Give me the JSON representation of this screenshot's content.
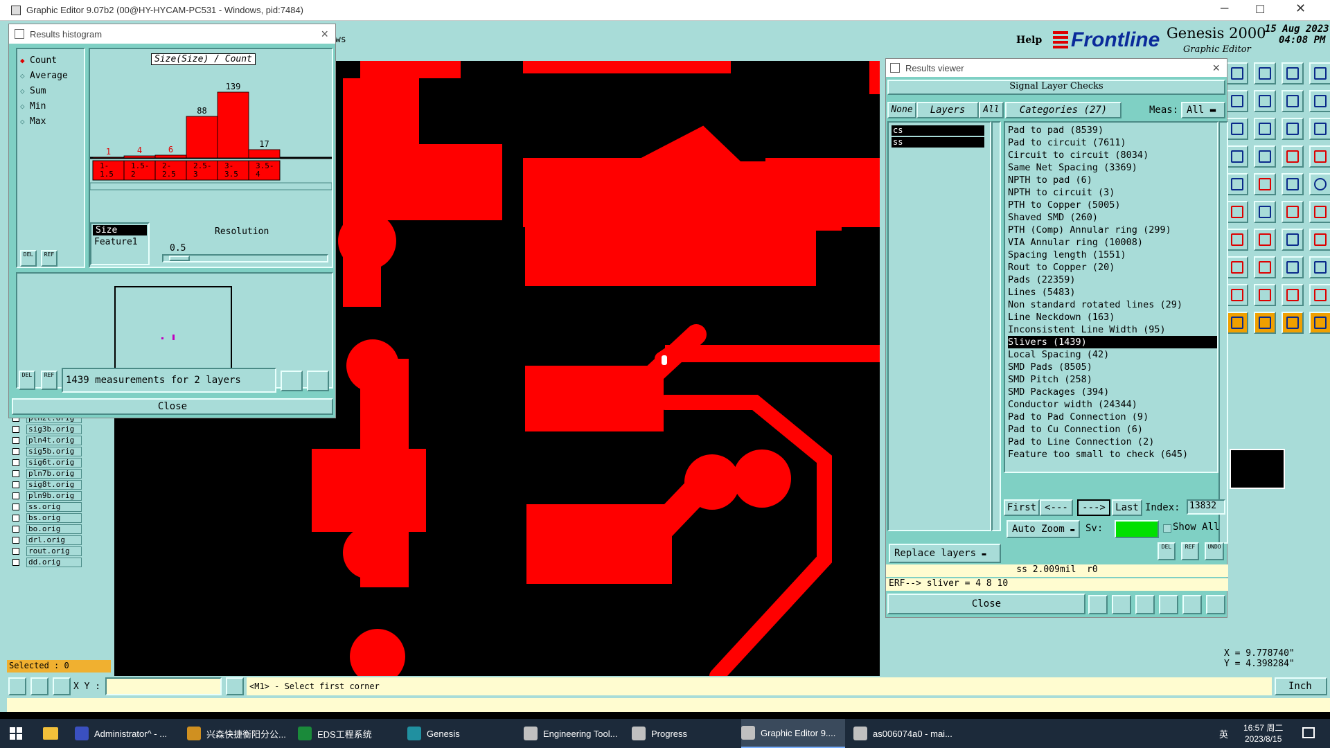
{
  "app": {
    "title": "Graphic Editor 9.07b2 (00@HY-HYCAM-PC531 - Windows, pid:7484)",
    "menu_fragment": "ws",
    "help_label": "Help",
    "brand": "Frontline",
    "product": "Genesis 2000",
    "subtitle": "Graphic Editor",
    "date": "15 Aug 2023",
    "time": "04:08 PM"
  },
  "histogram": {
    "title": "Results histogram",
    "close_x": "×",
    "options": [
      "Count",
      "Average",
      "Sum",
      "Min",
      "Max"
    ],
    "selected_option": "Count",
    "header": "Size(Size) / Count",
    "size_label": "Size",
    "feature_label": "Feature1",
    "resolution_label": "Resolution",
    "resolution_value": "0.5",
    "del_label": "DEL",
    "ref_label": "REF",
    "measurements": "1439 measurements for 2 layers",
    "close_label": "Close"
  },
  "chart_data": {
    "type": "bar",
    "title": "Size(Size) / Count",
    "categories": [
      "1-1.5",
      "1.5-2",
      "2-2.5",
      "2.5-3",
      "3-3.5",
      "3.5-4"
    ],
    "category_lines": [
      [
        "1-",
        "1.5"
      ],
      [
        "1.5-",
        "2"
      ],
      [
        "2-",
        "2.5"
      ],
      [
        "2.5-",
        "3"
      ],
      [
        "3-",
        "3.5"
      ],
      [
        "3.5-",
        "4"
      ]
    ],
    "values": [
      1,
      4,
      6,
      88,
      139,
      17
    ],
    "ymax": 139,
    "colors": {
      "bar": "#ff0000",
      "label_low": "#e00000",
      "label_high": "#000000"
    }
  },
  "layers": [
    "pln2t.orig",
    "sig3b.orig",
    "pln4t.orig",
    "sig5b.orig",
    "sig6t.orig",
    "pln7b.orig",
    "sig8t.orig",
    "pln9b.orig",
    "ss.orig",
    "bs.orig",
    "bo.orig",
    "drl.orig",
    "rout.orig",
    "dd.orig"
  ],
  "status": {
    "selected": "Selected : 0",
    "xy_label": "X Y :",
    "xy_value": "",
    "prompt": "<M1> - Select first corner",
    "unit": "Inch",
    "x_coord": "X = 9.778740\"",
    "y_coord": "Y = 4.398284\""
  },
  "results": {
    "title": "Results viewer",
    "close_x": "×",
    "heading": "Signal Layer Checks",
    "none_label": "None",
    "layers_label": "Layers",
    "all_label": "All",
    "categories_label": "Categories (27)",
    "meas_label": "Meas:",
    "meas_value": "All",
    "layer_items": [
      "cs",
      "ss"
    ],
    "categories": [
      "Pad to pad (8539)",
      "Pad to circuit (7611)",
      "Circuit to circuit (8034)",
      "Same Net Spacing (3369)",
      "NPTH to pad (6)",
      "NPTH to circuit (3)",
      "PTH to Copper (5005)",
      "Shaved SMD (260)",
      "PTH (Comp) Annular ring (299)",
      "VIA Annular ring (10008)",
      "Spacing length (1551)",
      "Rout to Copper (20)",
      "Pads (22359)",
      "Lines (5483)",
      "Non standard rotated lines (29)",
      "Line Neckdown (163)",
      "Inconsistent Line Width (95)",
      "Slivers (1439)",
      "Local Spacing (42)",
      "SMD Pads (8505)",
      "SMD Pitch (258)",
      "SMD Packages (394)",
      "Conductor width (24344)",
      "Pad to Pad Connection (9)",
      "Pad to Cu Connection (6)",
      "Pad to Line Connection (2)",
      "Feature too small to check (645)"
    ],
    "selected_category": "Slivers (1439)",
    "first": "First",
    "prev": "<---",
    "next": "--->",
    "last": "Last",
    "index_label": "Index:",
    "index_value": "13832",
    "auto_zoom": "Auto Zoom",
    "sv_label": "Sv:",
    "show_all": "Show All",
    "replace_layers": "Replace layers",
    "del_label": "DEL",
    "ref_label": "REF",
    "undo_label": "UNDO",
    "measure": "ss 2.009mil  r0",
    "erf": "ERF--> sliver = 4 8 10",
    "close_label": "Close"
  },
  "taskbar": {
    "items": [
      "Administrator^ - ...",
      "兴森快捷衡阳分公...",
      "EDS工程系统",
      "Genesis",
      "Engineering Tool...",
      "Progress",
      "Graphic Editor 9....",
      "as006074a0 - mai..."
    ],
    "active": "Graphic Editor 9....",
    "clock_time": "16:57 周二",
    "clock_date": "2023/8/15",
    "ime": "英"
  }
}
